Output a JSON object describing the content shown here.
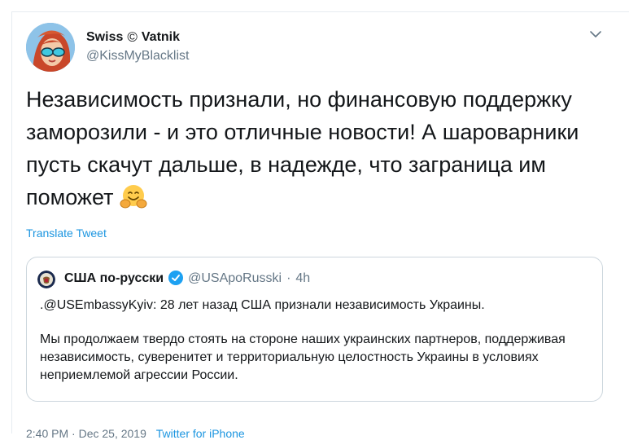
{
  "tweet": {
    "author_name_part1": "Swiss",
    "copyright_glyph": "©",
    "author_name_part2": "Vatnik",
    "handle": "@KissMyBlacklist",
    "text": "Независимость признали, но финансовую поддержку заморозили - и это отличные новости! А шароварники пусть скачут дальше, в надежде, что заграница им поможет",
    "emoji": "hugging-face-emoji",
    "translate_label": "Translate Tweet"
  },
  "quoted": {
    "name": "США по-русски",
    "handle": "@USApoRusski",
    "separator": "·",
    "time": "4h",
    "line1": ".@USEmbassyKyiv: 28 лет назад США признали независимость Украины.",
    "paragraph": "Мы продолжаем твердо стоять на стороне наших украинских партнеров, поддерживая независимость, суверенитет и территориальную целостность Украины в условиях неприемлемой агрессии России."
  },
  "footer": {
    "timestamp_partial": "2:40 PM · Dec 25, 2019",
    "source_partial": "Twitter for iPhone"
  },
  "colors": {
    "link": "#1b95e0",
    "secondary_text": "#657786",
    "border": "#ccd6dd",
    "verified": "#1da1f2"
  },
  "icons": {
    "caret": "chevron-down-icon",
    "verified": "verified-badge-icon",
    "quoted_avatar": "us-seal-avatar"
  }
}
